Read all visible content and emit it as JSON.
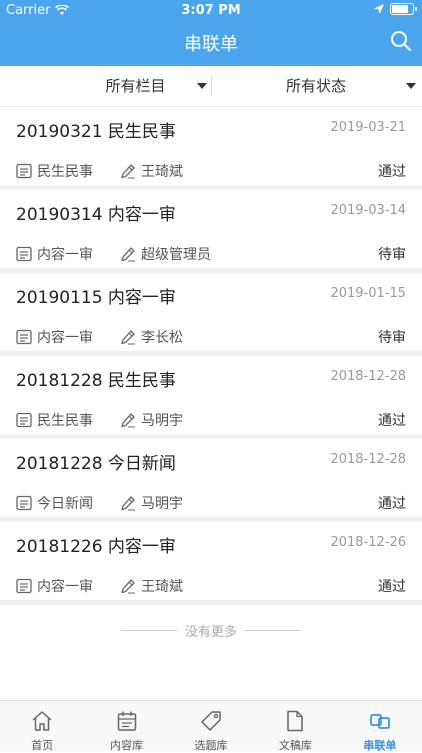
{
  "status_bar": {
    "carrier": "Carrier",
    "time": "3:07 PM"
  },
  "nav": {
    "title": "串联单"
  },
  "filters": {
    "column_label": "所有栏目",
    "status_label": "所有状态"
  },
  "items": [
    {
      "title": "20190321 民生民事",
      "date": "2019-03-21",
      "column": "民生民事",
      "author": "王琦斌",
      "status": "通过"
    },
    {
      "title": "20190314 内容一审",
      "date": "2019-03-14",
      "column": "内容一审",
      "author": "超级管理员",
      "status": "待审"
    },
    {
      "title": "20190115 内容一审",
      "date": "2019-01-15",
      "column": "内容一审",
      "author": "李长松",
      "status": "待审"
    },
    {
      "title": "20181228 民生民事",
      "date": "2018-12-28",
      "column": "民生民事",
      "author": "马明宇",
      "status": "通过"
    },
    {
      "title": "20181228 今日新闻",
      "date": "2018-12-28",
      "column": "今日新闻",
      "author": "马明宇",
      "status": "通过"
    },
    {
      "title": "20181226 内容一审",
      "date": "2018-12-26",
      "column": "内容一审",
      "author": "王琦斌",
      "status": "通过"
    }
  ],
  "footer_text": "没有更多",
  "tabs": [
    {
      "label": "首页",
      "icon": "home-icon"
    },
    {
      "label": "内容库",
      "icon": "calendar-icon"
    },
    {
      "label": "选题库",
      "icon": "tag-icon"
    },
    {
      "label": "文稿库",
      "icon": "document-icon"
    },
    {
      "label": "串联单",
      "icon": "link-icon",
      "active": true
    }
  ],
  "colors": {
    "header": "#4aa5ec",
    "active_tab": "#3b8fe0"
  }
}
